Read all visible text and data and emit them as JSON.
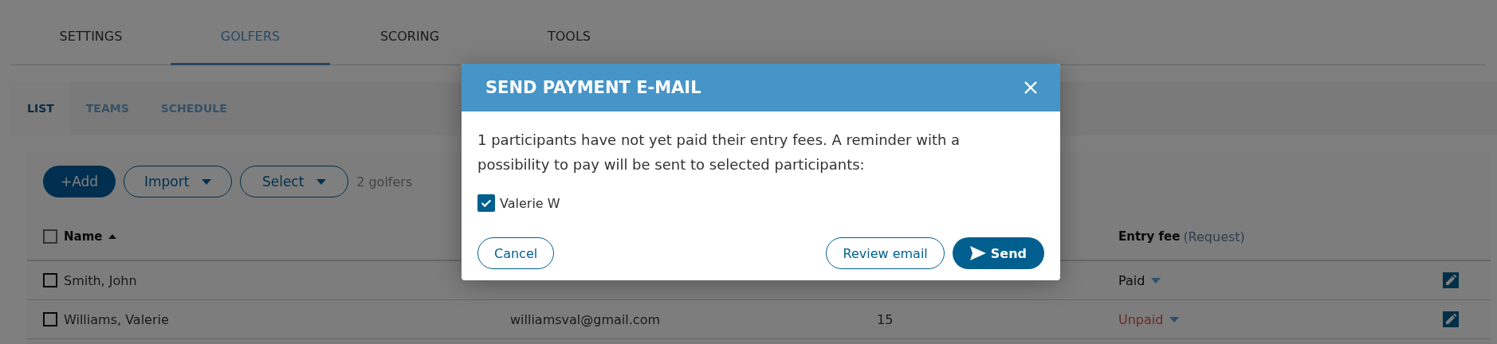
{
  "tabs": [
    {
      "label": "SETTINGS",
      "selected": false
    },
    {
      "label": "GOLFERS",
      "selected": true
    },
    {
      "label": "SCORING",
      "selected": false
    },
    {
      "label": "TOOLS",
      "selected": false
    }
  ],
  "subtabs": [
    {
      "label": "LIST",
      "selected": true
    },
    {
      "label": "TEAMS",
      "selected": false
    },
    {
      "label": "SCHEDULE",
      "selected": false
    }
  ],
  "toolbar": {
    "add": "+Add",
    "import": "Import",
    "select": "Select",
    "count": "2 golfers"
  },
  "table": {
    "header": {
      "checked": false,
      "name": "Name",
      "entry_fee": "Entry fee",
      "request": "(Request)"
    },
    "rows": [
      {
        "selected": false,
        "name": "Smith, John",
        "fee": "Paid",
        "paid": true
      },
      {
        "selected": false,
        "name": "Williams, Valerie",
        "email": "williamsval@gmail.com",
        "handicap": "15",
        "fee": "Unpaid",
        "paid": false
      }
    ]
  },
  "dialog": {
    "title": "SEND PAYMENT E-MAIL",
    "message": "1 participants have not yet paid their entry fees. A reminder with a possibility to pay will be sent to selected participants:",
    "participants": [
      {
        "name": "Valerie W",
        "checked": true
      }
    ],
    "buttons": {
      "cancel": "Cancel",
      "review": "Review email",
      "send": "Send"
    }
  }
}
